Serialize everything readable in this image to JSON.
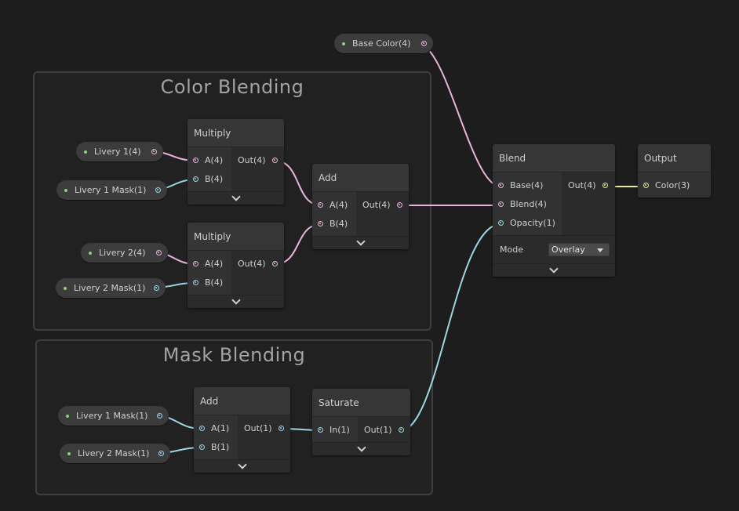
{
  "groups": {
    "color": {
      "title": "Color Blending"
    },
    "mask": {
      "title": "Mask Blending"
    }
  },
  "properties": {
    "base_color": "Base Color(4)",
    "livery1": "Livery 1(4)",
    "livery1_mask": "Livery 1 Mask(1)",
    "livery2": "Livery 2(4)",
    "livery2_mask": "Livery 2 Mask(1)",
    "mask_livery1_mask": "Livery 1 Mask(1)",
    "mask_livery2_mask": "Livery 2 Mask(1)"
  },
  "nodes": {
    "multiply1": {
      "title": "Multiply",
      "in_a": "A(4)",
      "in_b": "B(4)",
      "out": "Out(4)"
    },
    "multiply2": {
      "title": "Multiply",
      "in_a": "A(4)",
      "in_b": "B(4)",
      "out": "Out(4)"
    },
    "add_color": {
      "title": "Add",
      "in_a": "A(4)",
      "in_b": "B(4)",
      "out": "Out(4)"
    },
    "add_mask": {
      "title": "Add",
      "in_a": "A(1)",
      "in_b": "B(1)",
      "out": "Out(1)"
    },
    "saturate": {
      "title": "Saturate",
      "in": "In(1)",
      "out": "Out(1)"
    },
    "blend": {
      "title": "Blend",
      "in_base": "Base(4)",
      "in_blend": "Blend(4)",
      "in_opacity": "Opacity(1)",
      "out": "Out(4)",
      "mode_label": "Mode",
      "mode_value": "Overlay"
    },
    "output": {
      "title": "Output",
      "in_color": "Color(3)"
    }
  },
  "colors": {
    "wire_vector4": "#e8b4de",
    "wire_vector1": "#9cd6e4",
    "wire_vector3": "#e8e8a0",
    "dot_green": "#8ed07a",
    "background": "#1d1d1d"
  }
}
